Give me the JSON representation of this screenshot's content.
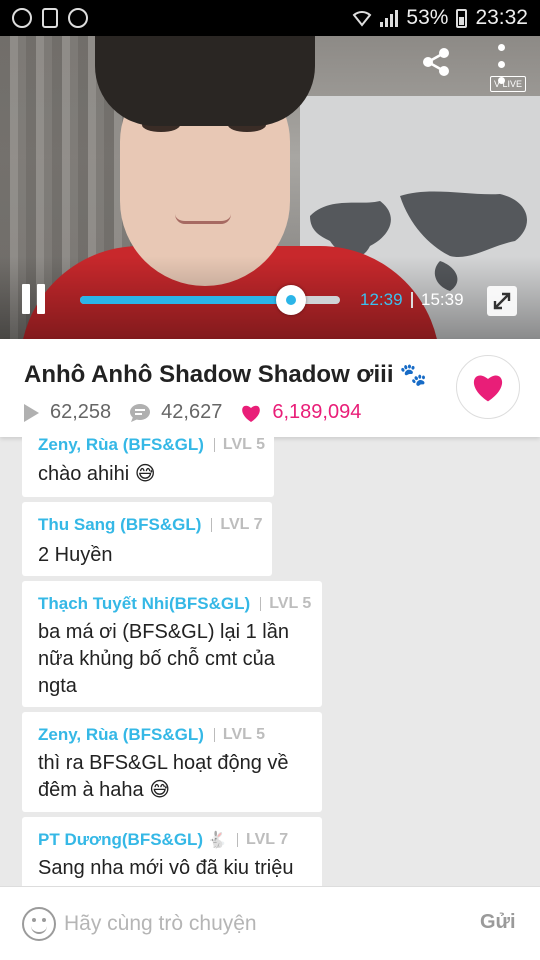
{
  "status_bar": {
    "battery": "53%",
    "time": "23:32"
  },
  "video": {
    "brand": "V LIVE",
    "current_time": "12:39",
    "total_time": "15:39",
    "progress": 0.81
  },
  "info": {
    "title": "Anhô Anhô Shadow Shadow ơiii",
    "views": "62,258",
    "comments": "42,627",
    "likes": "6,189,094"
  },
  "chat": {
    "messages": [
      {
        "name": "Zeny, Rùa (BFS&GL)",
        "level": "LVL 5",
        "text": [
          "chào ahihi 😅"
        ]
      },
      {
        "name": "Thu Sang (BFS&GL)",
        "level": "LVL 7",
        "text": [
          "2 Huyền"
        ]
      },
      {
        "name": "Thạch Tuyết Nhi(BFS&GL)",
        "level": "LVL 5",
        "text": [
          "ba má ơi (BFS&GL) lại 1 lần",
          "nữa khủng bố chỗ cmt của",
          "ngta"
        ]
      },
      {
        "name": "Zeny, Rùa (BFS&GL)",
        "level": "LVL 5",
        "text": [
          "thì ra BFS&GL hoạt động về",
          "đêm à haha 😅"
        ]
      },
      {
        "name": "PT Dương(BFS&GL)",
        "level": "LVL 7",
        "text": [
          "Sang nha mới vô đã kiu triệu"
        ]
      }
    ]
  },
  "input": {
    "placeholder": "Hãy cùng trò chuyện",
    "send_label": "Gửi"
  },
  "colors": {
    "accent_blue": "#35b8e6",
    "like_pink": "#e91e78"
  }
}
